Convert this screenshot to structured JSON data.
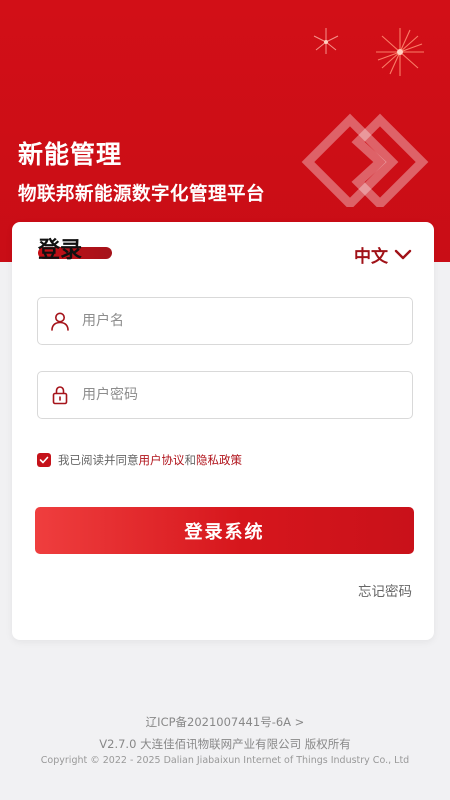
{
  "header": {
    "title": "新能管理",
    "subtitle": "物联邦新能源数字化管理平台"
  },
  "card": {
    "title": "登录",
    "language": "中文",
    "username": {
      "placeholder": "用户名",
      "value": "",
      "icon": "user-icon"
    },
    "password": {
      "placeholder": "用户密码",
      "value": "",
      "icon": "lock-icon"
    },
    "agreement": {
      "checked": true,
      "prefix": "我已阅读并同意",
      "user_agreement": "用户协议",
      "conjunction": "和",
      "privacy_policy": "隐私政策"
    },
    "login_button": "登录系统",
    "forgot_password": "忘记密码"
  },
  "footer": {
    "icp": "辽ICP备2021007441号-6A >",
    "version": "V2.7.0 大连佳佰讯物联网产业有限公司 版权所有",
    "copyright": "Copyright © 2022 - 2025 Dalian Jiabaixun Internet of Things Industry Co., Ltd"
  },
  "colors": {
    "brand_red": "#c90d16",
    "link_red": "#b0121a",
    "background": "#f1f1f3"
  }
}
